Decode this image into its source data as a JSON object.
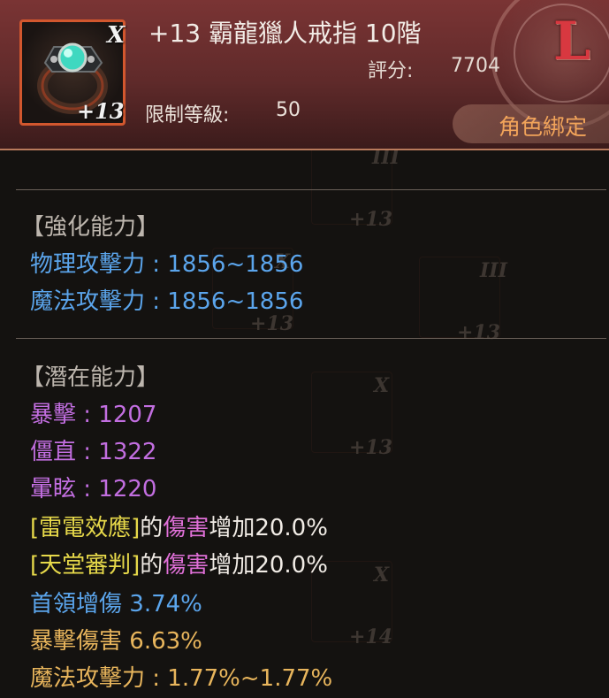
{
  "item": {
    "name": "+13 霸龍獵人戒指 10階",
    "tier_mark": "X",
    "enhance_label": "+13",
    "score_label": "評分:",
    "score_value": "7704",
    "level_label": "限制等級:",
    "level_value": "50",
    "grade_letter": "L",
    "bind_label": "角色綁定",
    "icon": "ring-icon"
  },
  "sections": {
    "enhance": {
      "title": "【強化能力】",
      "lines": [
        "物理攻擊力 : 1856~1856",
        "魔法攻擊力 : 1856~1856"
      ]
    },
    "potential": {
      "title": "【潛在能力】",
      "lines": [
        "暴擊 : 1207",
        "僵直 : 1322",
        "暈眩 : 1220"
      ],
      "effects": [
        {
          "skill": "[雷電效應]",
          "mid": "的",
          "word": "傷害",
          "rest": "增加20.0%"
        },
        {
          "skill": "[天堂審判]",
          "mid": "的",
          "word": "傷害",
          "rest": "增加20.0%"
        }
      ],
      "boss_label": "首領增傷",
      "boss_value": "3.74%",
      "crit_dmg_label": "暴擊傷害",
      "crit_dmg_value": "6.63%",
      "magic_atk": "魔法攻擊力 : 1.77%~1.77%"
    }
  },
  "background_items": [
    {
      "tier": "III",
      "plus": "+13"
    },
    {
      "tier": "III",
      "plus": "+13"
    },
    {
      "tier": "X",
      "plus": "+13"
    },
    {
      "tier": "X",
      "plus": "+13"
    },
    {
      "tier": "X",
      "plus": "+14"
    }
  ],
  "colors": {
    "header": "#6a2e2e",
    "stat_blue": "#5ba5ec",
    "stat_purple": "#c26ee0",
    "skill_yellow": "#e7d94a",
    "damage_pink": "#e070d8",
    "bonus_gold": "#e8b55c",
    "grade_red": "#d83840",
    "bind_orange": "#f2a45a"
  }
}
